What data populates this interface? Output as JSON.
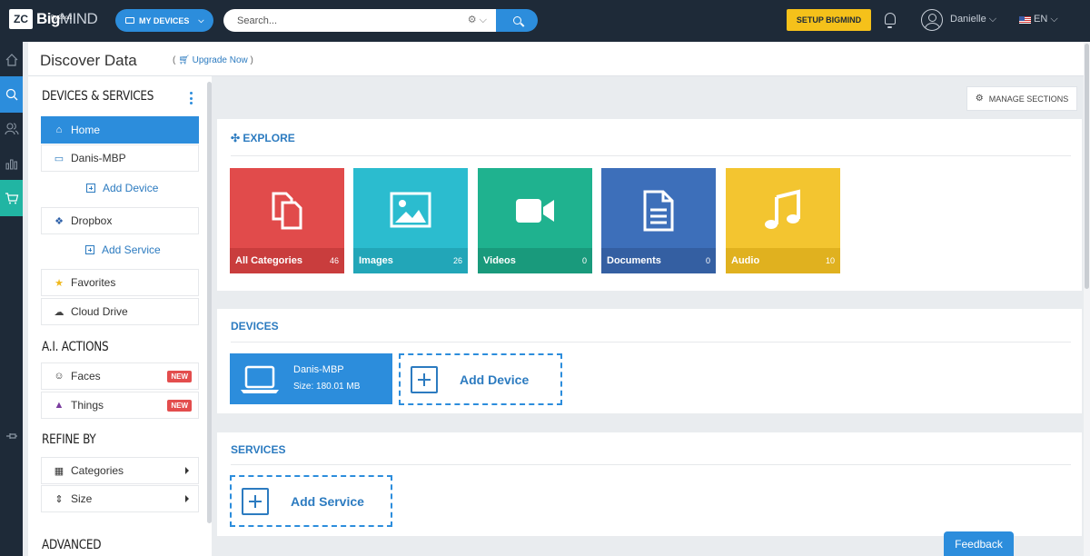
{
  "app": {
    "logo_mark": "ZC",
    "logo_bold": "Big",
    "logo_thin": "MIND",
    "logo_sub": "By Zoolz"
  },
  "topbar": {
    "devices_label": "MY DEVICES",
    "search_placeholder": "Search...",
    "setup_label": "SETUP BIGMIND",
    "username": "Danielle ⌵",
    "language": "EN ⌵"
  },
  "header": {
    "title": "Discover Data",
    "upgrade_open": "(",
    "upgrade_label": "Upgrade Now",
    "upgrade_close": ")"
  },
  "sidebar": {
    "devices_title": "DEVICES & SERVICES",
    "home": "Home",
    "device": "Danis-MBP",
    "add_device": "Add Device",
    "dropbox": "Dropbox",
    "add_service": "Add Service",
    "favorites": "Favorites",
    "cloud_drive": "Cloud Drive",
    "ai_title": "A.I. ACTIONS",
    "faces": "Faces",
    "things": "Things",
    "new_badge": "NEW",
    "refine_title": "REFINE BY",
    "categories": "Categories",
    "size": "Size",
    "advanced_title": "ADVANCED"
  },
  "main": {
    "manage_label": "MANAGE SECTIONS",
    "explore_title": "EXPLORE",
    "tiles": [
      {
        "label": "All Categories",
        "count": "46",
        "color": "#e14b4b"
      },
      {
        "label": "Images",
        "count": "26",
        "color": "#2bbccf"
      },
      {
        "label": "Videos",
        "count": "0",
        "color": "#1fb28f"
      },
      {
        "label": "Documents",
        "count": "0",
        "color": "#3d6fba"
      },
      {
        "label": "Audio",
        "count": "10",
        "color": "#f3c530"
      }
    ],
    "devices_title": "DEVICES",
    "device_name": "Danis-MBP",
    "device_size": "Size: 180.01 MB",
    "add_device": "Add Device",
    "services_title": "SERVICES",
    "add_service": "Add Service"
  },
  "feedback_label": "Feedback",
  "colors": {
    "topbar": "#1e2a38",
    "accent": "#2c8ddc",
    "setup": "#f5c11a",
    "teal": "#21b5a3"
  }
}
